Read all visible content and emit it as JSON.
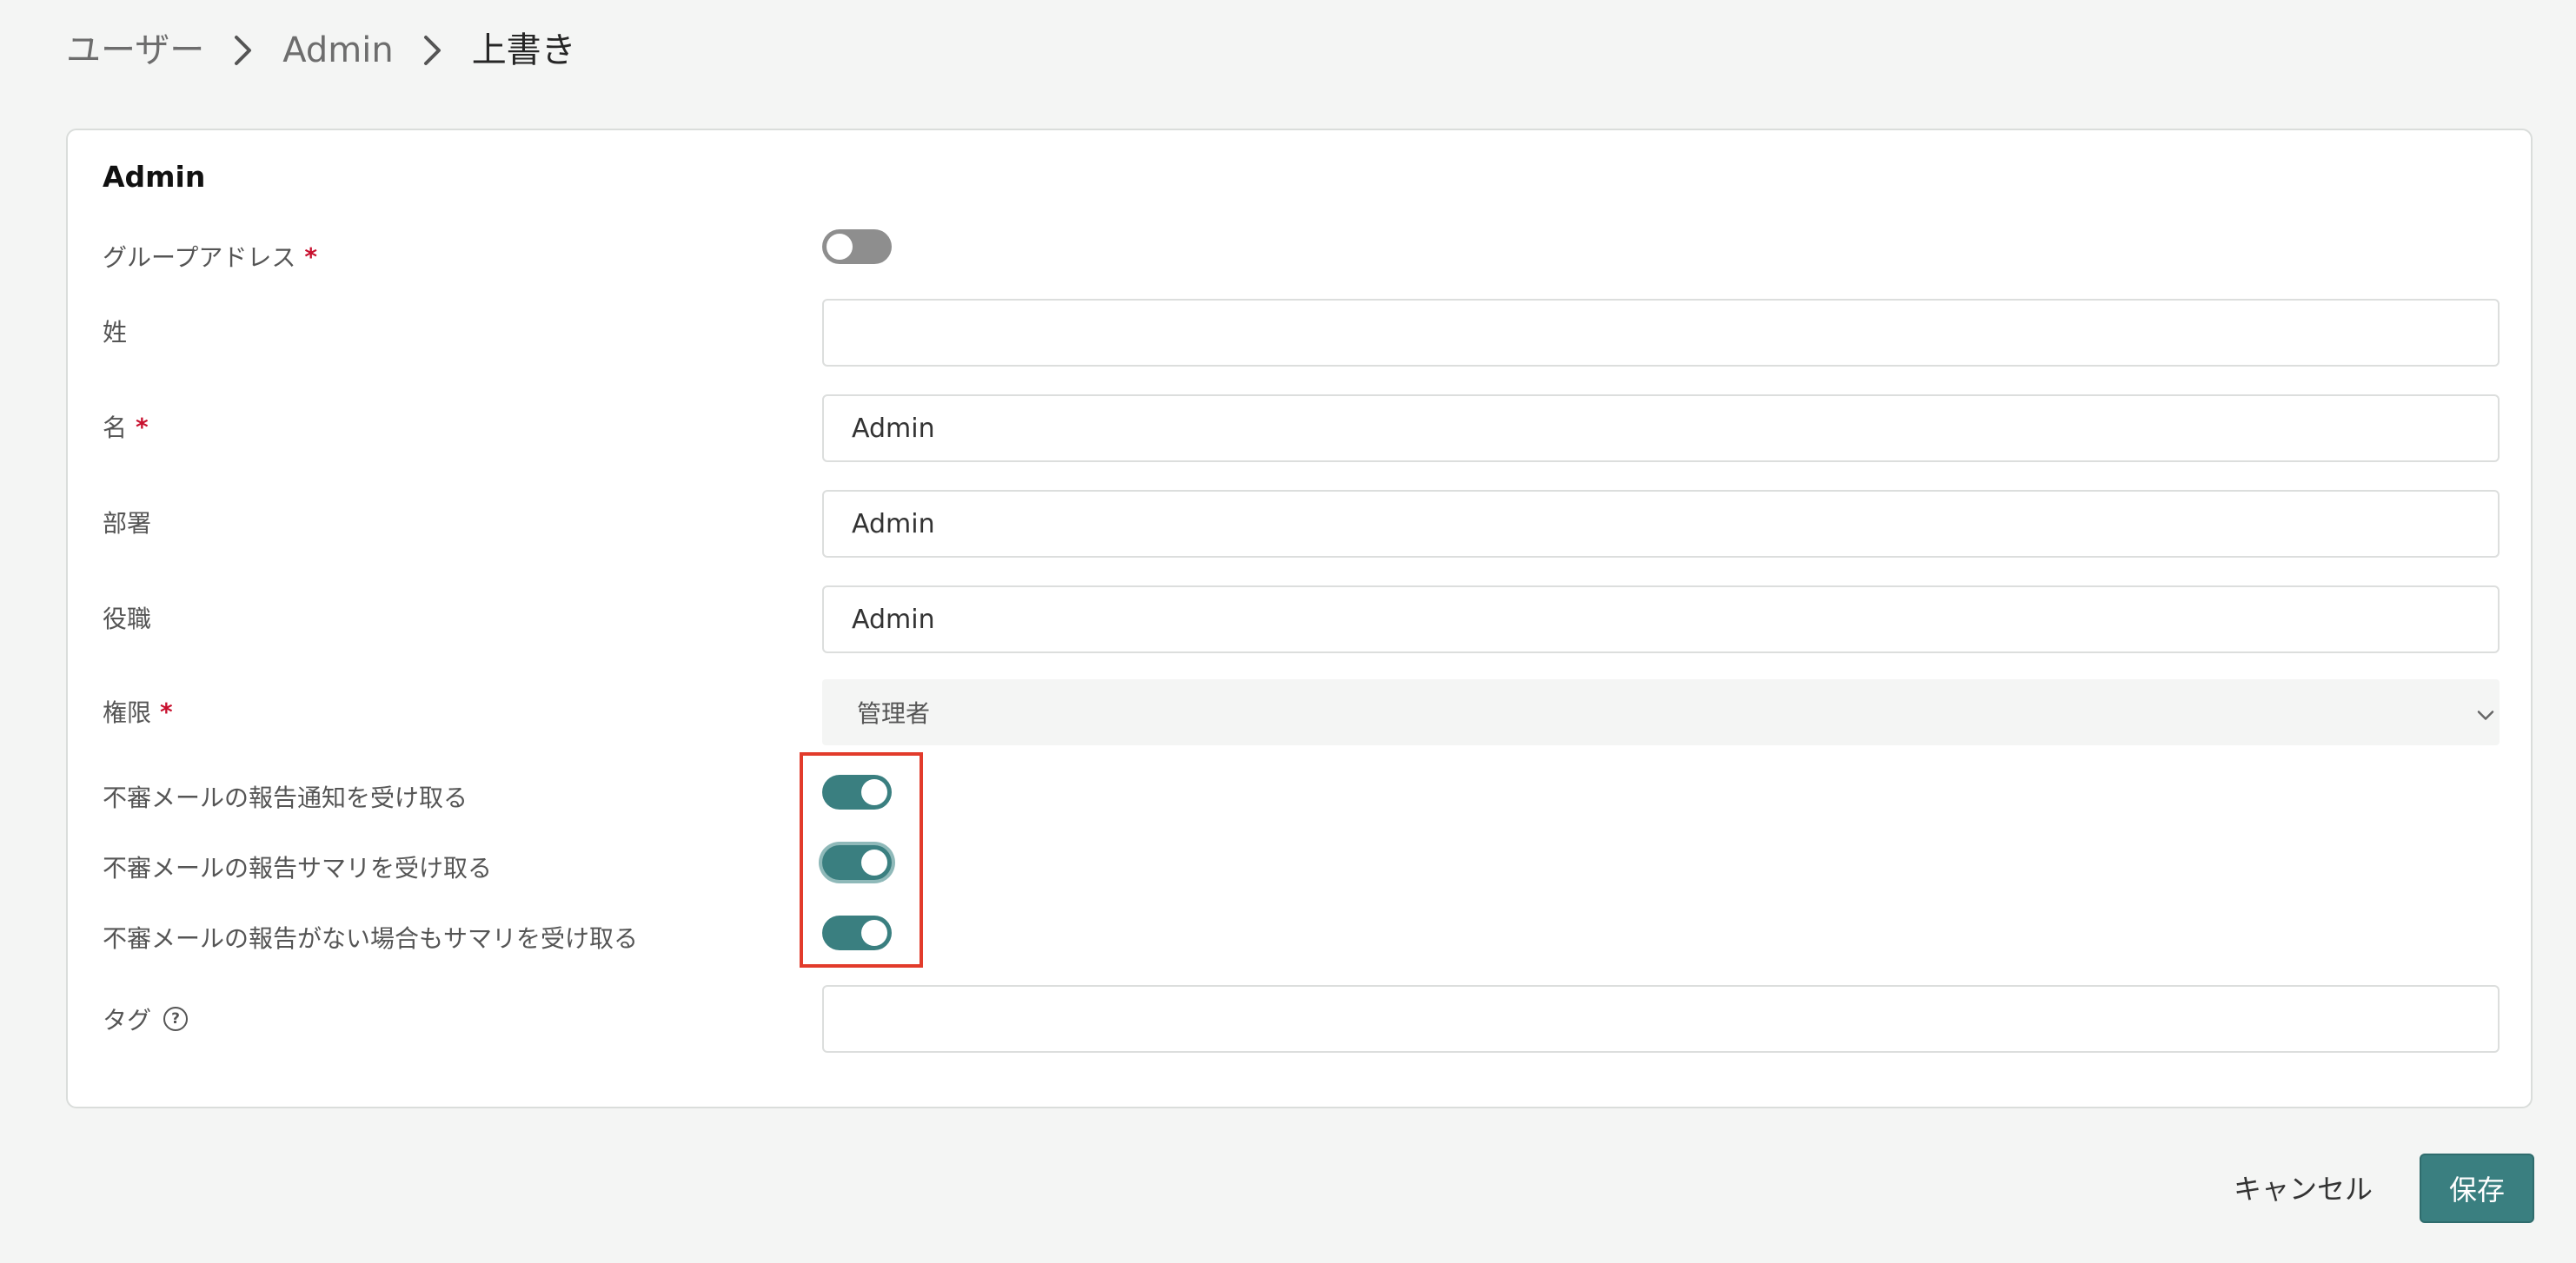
{
  "breadcrumb": {
    "items": [
      "ユーザー",
      "Admin",
      "上書き"
    ]
  },
  "card": {
    "title": "Admin"
  },
  "fields": {
    "group_address": {
      "label": "グループアドレス",
      "required": "*",
      "enabled": false
    },
    "last_name": {
      "label": "姓",
      "value": ""
    },
    "first_name": {
      "label": "名",
      "required": "*",
      "value": "Admin"
    },
    "department": {
      "label": "部署",
      "value": "Admin"
    },
    "position": {
      "label": "役職",
      "value": "Admin"
    },
    "role": {
      "label": "権限",
      "required": "*",
      "selected": "管理者"
    },
    "notify_report": {
      "label": "不審メールの報告通知を受け取る",
      "enabled": true
    },
    "report_summary": {
      "label": "不審メールの報告サマリを受け取る",
      "enabled": true
    },
    "summary_no_report": {
      "label": "不審メールの報告がない場合もサマリを受け取る",
      "enabled": true
    },
    "tags": {
      "label": "タグ",
      "help_icon": "?",
      "value": ""
    }
  },
  "footer": {
    "cancel_label": "キャンセル",
    "save_label": "保存"
  },
  "colors": {
    "accent": "#3a7f80",
    "required": "#c8102e",
    "highlight": "#e23b2b",
    "toggle_off": "#8e8e8e"
  },
  "icons": {
    "breadcrumb_separator": "chevron-right-icon",
    "select_arrow": "chevron-down-icon",
    "help": "question-circle-icon"
  }
}
